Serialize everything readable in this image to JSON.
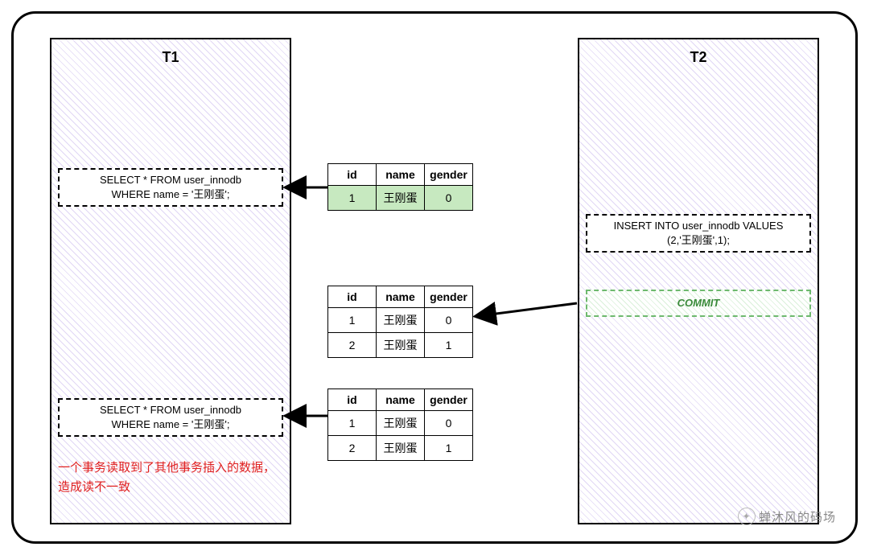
{
  "t1": {
    "title": "T1"
  },
  "t2": {
    "title": "T2"
  },
  "stmt1": {
    "line1": "SELECT * FROM user_innodb",
    "line2": "WHERE name = '王刚蛋';"
  },
  "stmt2": {
    "line1": "INSERT INTO user_innodb VALUES",
    "line2": "(2,'王刚蛋',1);"
  },
  "commit": {
    "label": "COMMIT"
  },
  "stmt3": {
    "line1": "SELECT * FROM user_innodb",
    "line2": "WHERE name = '王刚蛋';"
  },
  "note": {
    "text": "一个事务读取到了其他事务插入的数据，造成读不一致"
  },
  "headers": {
    "id": "id",
    "name": "name",
    "gender": "gender"
  },
  "table1": {
    "rows": [
      {
        "id": "1",
        "name": "王刚蛋",
        "gender": "0"
      }
    ]
  },
  "table2": {
    "rows": [
      {
        "id": "1",
        "name": "王刚蛋",
        "gender": "0"
      },
      {
        "id": "2",
        "name": "王刚蛋",
        "gender": "1"
      }
    ]
  },
  "table3": {
    "rows": [
      {
        "id": "1",
        "name": "王刚蛋",
        "gender": "0"
      },
      {
        "id": "2",
        "name": "王刚蛋",
        "gender": "1"
      }
    ]
  },
  "watermark": {
    "text": "蝉沐风的码场"
  }
}
